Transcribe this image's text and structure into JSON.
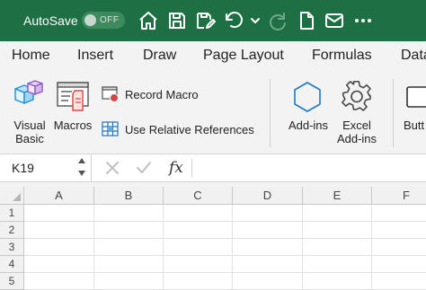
{
  "titlebar": {
    "autosave_label": "AutoSave",
    "autosave_state": "OFF",
    "background_color": "#1e7044",
    "icons": [
      "home-icon",
      "save-icon",
      "save-as-icon",
      "undo-icon",
      "undo-dropdown-icon",
      "redo-icon",
      "new-document-icon",
      "mail-icon",
      "more-icon"
    ]
  },
  "menu": {
    "tabs": [
      "Home",
      "Insert",
      "Draw",
      "Page Layout",
      "Formulas",
      "Data"
    ]
  },
  "ribbon": {
    "visual_basic": "Visual Basic",
    "visual_basic_line1": "Visual",
    "visual_basic_line2": "Basic",
    "macros": "Macros",
    "record_macro": "Record Macro",
    "use_relative_references": "Use Relative References",
    "add_ins": "Add-ins",
    "excel_add_ins": "Excel Add-ins",
    "excel_add_ins_line1": "Excel",
    "excel_add_ins_line2": "Add-ins",
    "button": "Butt"
  },
  "formula_bar": {
    "name_box": "K19",
    "fx": "fx",
    "formula": ""
  },
  "grid": {
    "columns": [
      "A",
      "B",
      "C",
      "D",
      "E",
      "F"
    ],
    "rows": [
      "1",
      "2",
      "3",
      "4",
      "5"
    ]
  }
}
